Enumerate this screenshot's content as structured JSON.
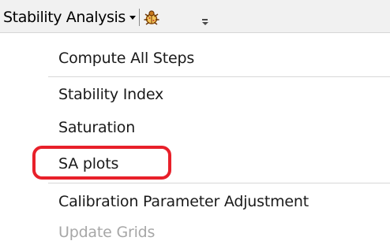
{
  "toolbar": {
    "menu_label": "Stability Analysis",
    "tool_icon": "pest-bug-icon",
    "overflow_icon": "toolbar-overflow-icon"
  },
  "menu": {
    "items": [
      {
        "label": "Compute All Steps",
        "enabled": true
      },
      {
        "label": "Stability Index",
        "enabled": true
      },
      {
        "label": "Saturation",
        "enabled": true
      },
      {
        "label": "SA plots",
        "enabled": true,
        "highlighted": true
      },
      {
        "label": "Calibration Parameter Adjustment",
        "enabled": true
      },
      {
        "label": "Update Grids",
        "enabled": false
      }
    ]
  },
  "colors": {
    "highlight_ring": "#e8202a",
    "toolbar_bg": "#f1f1f1",
    "disabled_text": "#a7a7a7"
  }
}
